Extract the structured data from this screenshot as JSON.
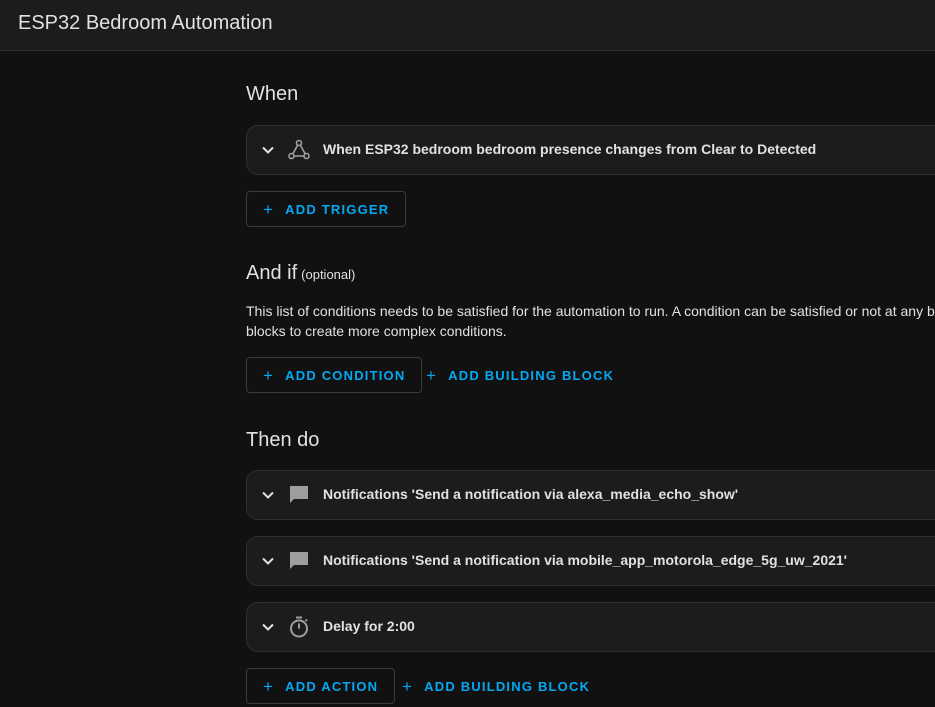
{
  "window": {
    "title": "ESP32 Bedroom Automation"
  },
  "when": {
    "heading": "When",
    "triggers": [
      {
        "icon": "trigger-nodes-icon",
        "label": "When ESP32 bedroom bedroom presence changes from Clear to Detected"
      }
    ],
    "add_trigger_label": "ADD TRIGGER"
  },
  "and_if": {
    "heading": "And if",
    "optional_label": "(optional)",
    "description": "This list of conditions needs to be satisfied for the automation to run. A condition can be satisfied or not at any building blocks to create more complex conditions.",
    "add_condition_label": "ADD CONDITION",
    "add_building_block_label": "ADD BUILDING BLOCK"
  },
  "then_do": {
    "heading": "Then do",
    "actions": [
      {
        "icon": "message-icon",
        "label": "Notifications 'Send a notification via alexa_media_echo_show'"
      },
      {
        "icon": "message-icon",
        "label": "Notifications 'Send a notification via mobile_app_motorola_edge_5g_uw_2021'"
      },
      {
        "icon": "timer-icon",
        "label": "Delay for 2:00"
      }
    ],
    "add_action_label": "ADD ACTION",
    "add_building_block_label": "ADD BUILDING BLOCK"
  },
  "colors": {
    "background": "#111111",
    "card": "#1c1c1c",
    "accent": "#03a9f4",
    "text": "#e1e1e1"
  }
}
